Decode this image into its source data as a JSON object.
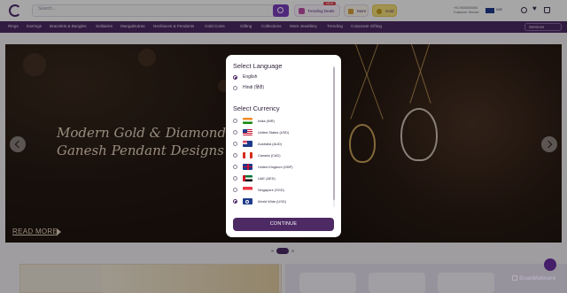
{
  "header": {
    "search_placeholder": "Search...",
    "trending_label": "Trending Deals",
    "trending_badge": "NEW",
    "more_label": "More",
    "gold_label": "Gold",
    "contact_line1": "+91 9000000000",
    "contact_line2": "Customer Service",
    "currency_label": "INR"
  },
  "nav": {
    "items": [
      "Rings",
      "Earrings",
      "Bracelets & Bangles",
      "Solitaires",
      "Mangalsutras",
      "Necklaces & Pendants",
      "Gold Coins",
      "Gifting",
      "Collections",
      "More Jewellery",
      "Trending",
      "Corporate Gifting"
    ],
    "select_label": "Services"
  },
  "banner": {
    "title_line1": "Modern Gold & Diamond",
    "title_line2": "Ganesh Pendant Designs",
    "read_more": "READ MORE"
  },
  "modal": {
    "language_title": "Select Language",
    "languages": [
      {
        "label": "English",
        "selected": true
      },
      {
        "label": "Hindi (हिंदी)",
        "selected": false
      }
    ],
    "currency_title": "Select Currency",
    "currencies": [
      {
        "label": "India (INR)",
        "flag": "india-flag",
        "selected": false
      },
      {
        "label": "United States (USD)",
        "flag": "us-flag",
        "selected": false
      },
      {
        "label": "Australia (AUD)",
        "flag": "australia-flag",
        "selected": false
      },
      {
        "label": "Canada (CAD)",
        "flag": "canada-flag",
        "selected": false
      },
      {
        "label": "United Kingdom (GBP)",
        "flag": "uk-flag",
        "selected": false
      },
      {
        "label": "UAE (AED)",
        "flag": "uae-flag",
        "selected": false
      },
      {
        "label": "Singapore (SGD)",
        "flag": "singapore-flag",
        "selected": false
      },
      {
        "label": "World Wide (USD)",
        "flag": "world-flag",
        "selected": true
      }
    ],
    "continue_label": "CONTINUE"
  },
  "pager": {
    "label": "1/5"
  },
  "watermark": "ScanMalware",
  "colors": {
    "brand": "#4e2a64",
    "accent": "#7b3fbf",
    "gold": "#f6e27a"
  }
}
